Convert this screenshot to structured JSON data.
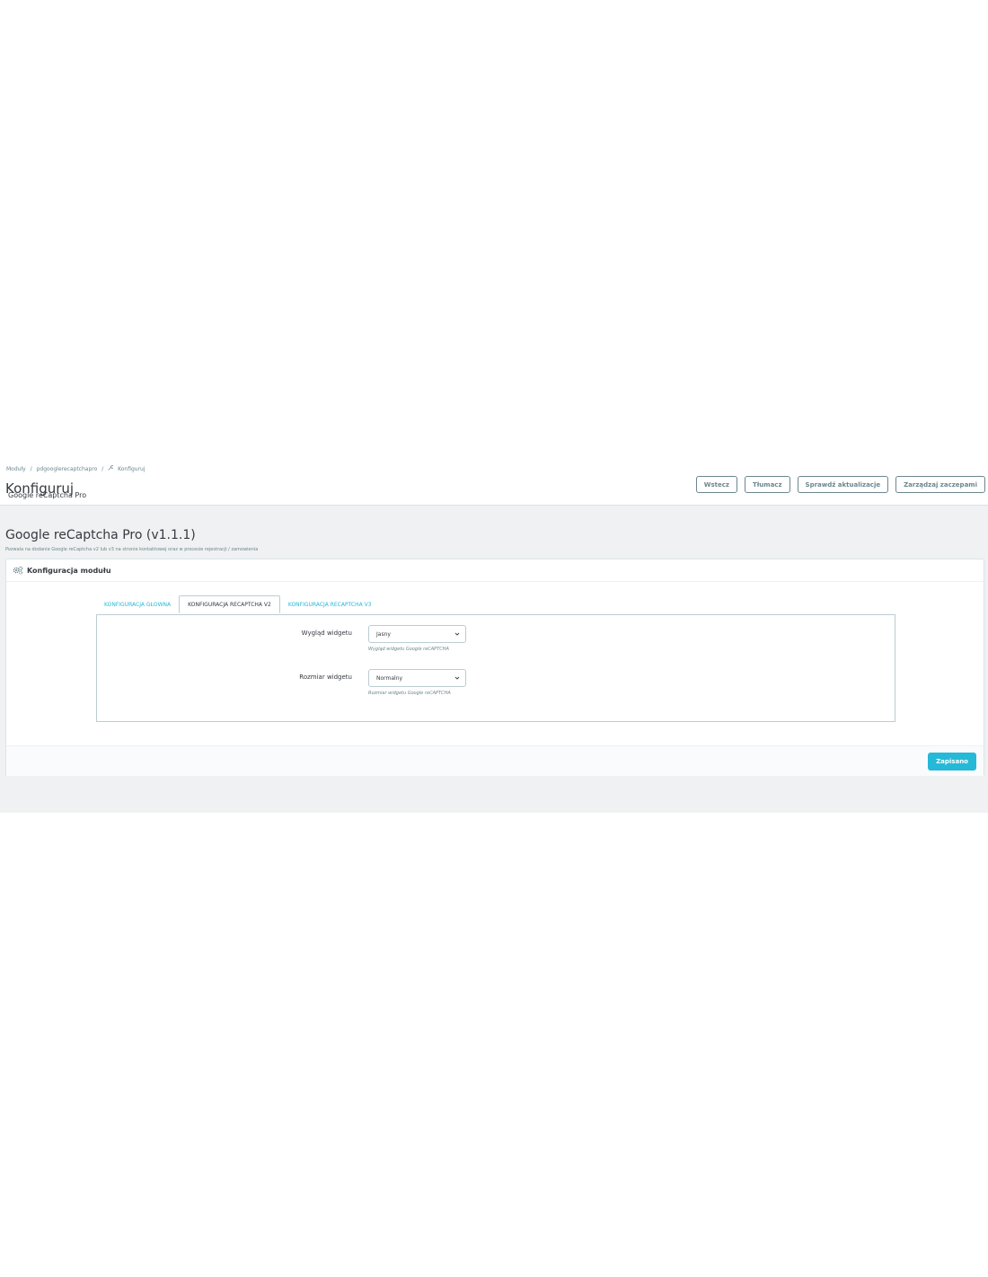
{
  "breadcrumb": {
    "items": [
      "Moduły",
      "pdgooglerecaptchapro",
      "Konfiguruj"
    ],
    "separator": "/"
  },
  "header": {
    "title": "Konfiguruj",
    "subtitle": "Google reCaptcha Pro"
  },
  "toolbar": {
    "back_label": "Wstecz",
    "translate_label": "Tłumacz",
    "check_updates_label": "Sprawdź aktualizacje",
    "manage_hooks_label": "Zarządzaj zaczepami"
  },
  "module": {
    "title": "Google reCaptcha Pro (v1.1.1)",
    "description": "Pozwala na dodanie Google reCaptcha v2 lub v3 na stronie kontaktowej oraz w procesie rejestracji / zamowienia"
  },
  "panel": {
    "heading": "Konfiguracja modułu",
    "tabs": [
      {
        "label": "KONFIGURACJA GŁOWNA"
      },
      {
        "label": "KONFIGURACJA RECAPTCHA V2"
      },
      {
        "label": "KONFIGURACJA RECAPTCHA V3"
      }
    ],
    "active_tab": "KONFIGURACJA RECAPTCHA V2",
    "fields": [
      {
        "label": "Wygląd widgetu",
        "value": "Jasny",
        "help": "Wygląd widgetu Google reCAPTCHA"
      },
      {
        "label": "Rozmiar widgetu",
        "value": "Normalny",
        "help": "Rozmiar widgetu Google reCAPTCHA"
      }
    ],
    "save_label": "Zapisano"
  },
  "colors": {
    "accent": "#25b9d7",
    "background": "#eff1f2",
    "text": "#363a41",
    "muted": "#6c868e"
  }
}
